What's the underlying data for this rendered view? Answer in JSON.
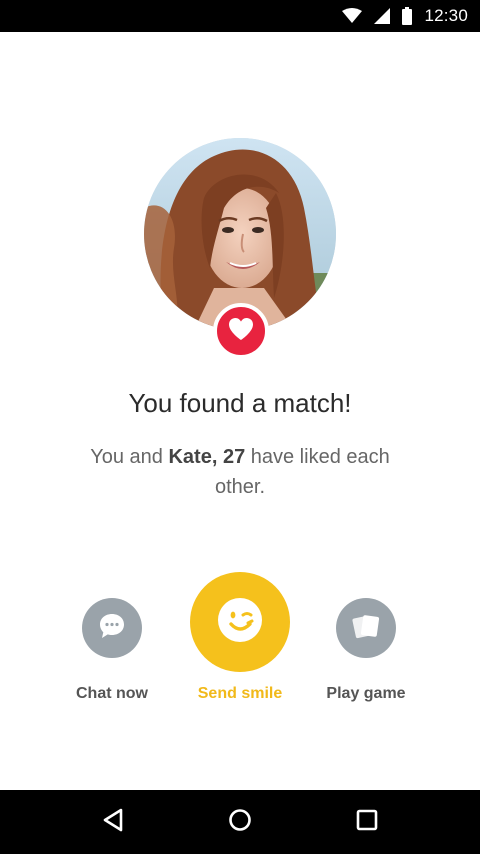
{
  "status_bar": {
    "time": "12:30",
    "icons": [
      "wifi-icon",
      "cell-signal-icon",
      "battery-icon"
    ]
  },
  "match": {
    "title": "You found a match!",
    "subtitle_prefix": "You and ",
    "subtitle_name": "Kate, 27",
    "subtitle_suffix": " have liked each other."
  },
  "actions": {
    "chat": {
      "label": "Chat now",
      "icon": "chat-bubble-icon"
    },
    "smile": {
      "label": "Send smile",
      "icon": "wink-smile-icon"
    },
    "game": {
      "label": "Play game",
      "icon": "cards-icon"
    }
  },
  "colors": {
    "heart_red": "#e8233f",
    "smile_yellow": "#f5c11c",
    "gray_action": "#9aa3aa"
  },
  "nav_bar": {
    "icons": [
      "back-icon",
      "home-icon",
      "recents-icon"
    ]
  }
}
